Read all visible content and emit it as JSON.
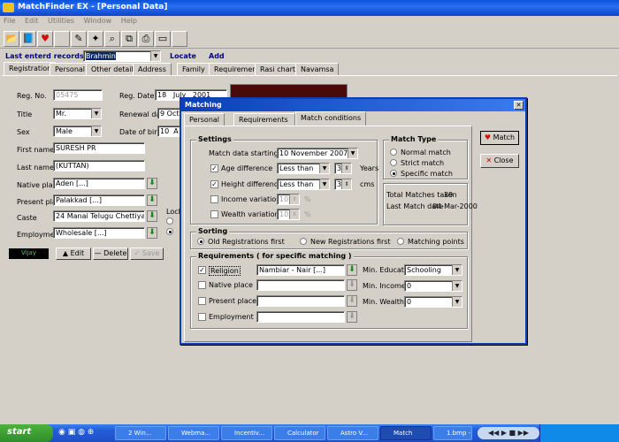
{
  "window": {
    "title": "MatchFinder EX  - [Personal Data]"
  },
  "menu": [
    "File",
    "Edit",
    "Utilities",
    "Window",
    "Help"
  ],
  "toolbar_icons": [
    "folder-icon",
    "book-icon",
    "hearts-icon",
    "blank-icon",
    "pen-icon",
    "wand-icon",
    "magnifier-icon",
    "copy-icon",
    "printer-icon",
    "doc-icon",
    "blank2-icon"
  ],
  "records_bar": {
    "label": "Last enterd records List",
    "selected": "Brahmin",
    "locate": "Locate",
    "add": "Add"
  },
  "main_tabs": [
    "Registration",
    "Personal",
    "Other details",
    "Address",
    "Family",
    "Requirements",
    "Rasi chart",
    "Navamsa"
  ],
  "form": {
    "reg_no_label": "Reg. No.",
    "reg_no": "05475",
    "reg_date_label": "Reg. Date",
    "reg_date_day": "18",
    "reg_date_month": "July",
    "reg_date_year": "2001",
    "title_label": "Title",
    "title": "Mr.",
    "renewal_label": "Renewal date",
    "renewal_day": "9",
    "renewal_month": "Oct",
    "sex_label": "Sex",
    "sex": "Male",
    "dob_label": "Date of birth",
    "dob_day": "10",
    "dob_month": "A",
    "first_name_label": "First name",
    "first_name": "SURESH PR",
    "last_name_label": "Last name",
    "last_name": "(KUTTAN)",
    "native_label": "Native place",
    "native": "Aden [...]",
    "present_label": "Present place",
    "present": "Palakkad [...]",
    "caste_label": "Caste",
    "caste": "24 Manai Telugu Chettiyar [...]",
    "employment_label": "Employment",
    "employment": "Wholesale [...]",
    "lock_label": "Lock",
    "status": "Vijay",
    "edit": "Edit",
    "delete": "Delete",
    "save": "Save"
  },
  "dialog": {
    "title": "Matching",
    "tabs": [
      "Personal",
      "Requirements",
      "Match conditions"
    ],
    "settings_title": "Settings",
    "match_from_label": "Match data starting from",
    "match_from": "10 November 2007",
    "age_label": "Age difference",
    "age_cond": "Less than",
    "age_val": "3",
    "age_unit": "Years",
    "height_label": "Height difference",
    "height_cond": "Less than",
    "height_val": "3",
    "height_unit": "cms",
    "income_label": "Income variation",
    "income_val": "10",
    "income_unit": "%",
    "wealth_label": "Wealth variation",
    "wealth_val": "10",
    "wealth_unit": "%",
    "match_type_title": "Match Type",
    "match_types": [
      "Normal match",
      "Strict match",
      "Specific match"
    ],
    "total_label": "Total Matches taken",
    "total_val": "39",
    "last_match_label": "Last Match date",
    "last_match_val": "04-Mar-2000",
    "sorting_title": "Sorting",
    "sorting_options": [
      "Old  Registrations first",
      "New Registrations first",
      "Matching points"
    ],
    "req_title": "Requirements  ( for specific matching )",
    "req_religion": "Religion",
    "req_religion_val": "Nambiar - Nair [...]",
    "req_native": "Native place",
    "req_present": "Present place",
    "req_employment": "Employment",
    "min_edu_label": "Min. Education",
    "min_edu": "Schooling",
    "min_income_label": "Min. Income",
    "min_income": "0",
    "min_wealth_label": "Min. Wealth",
    "min_wealth": "0",
    "match_btn": "Match",
    "close_btn": "Close"
  },
  "taskbar": {
    "start": "start",
    "tasks": [
      "2 Win...",
      "Webma...",
      "Incentiv...",
      "Calculator",
      "Astro V...",
      "Match",
      "1.bmp - ..."
    ]
  }
}
